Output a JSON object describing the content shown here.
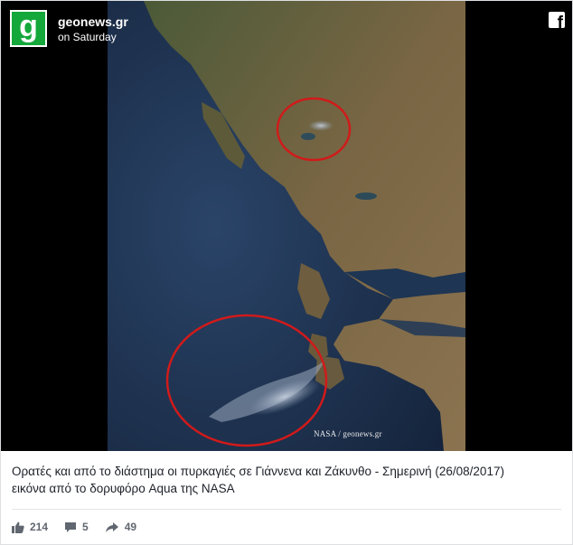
{
  "post": {
    "page_name": "geonews.gr",
    "timestamp": "on Saturday",
    "logo_letter": "g",
    "brand_color": "#14a83b",
    "platform_icon": "facebook-icon",
    "image_watermark": "NASA / geonews.gr",
    "caption_line1": "Ορατές και από το διάστημα οι πυρκαγιές σε Γιάννενα και Ζάκυνθο - Σημερινή (26/08/2017)",
    "caption_line2": "εικόνα από το δορυφόρο Aqua της NASA"
  },
  "actions": {
    "likes": "214",
    "comments": "5",
    "shares": "49",
    "icons": [
      "like-icon",
      "comment-icon",
      "share-icon"
    ]
  },
  "colors": {
    "sea": "#1b2f4d",
    "land": "#6b5a3a",
    "highlight_circle": "#d11a1a",
    "text": "#1d2129",
    "muted": "#616770"
  }
}
